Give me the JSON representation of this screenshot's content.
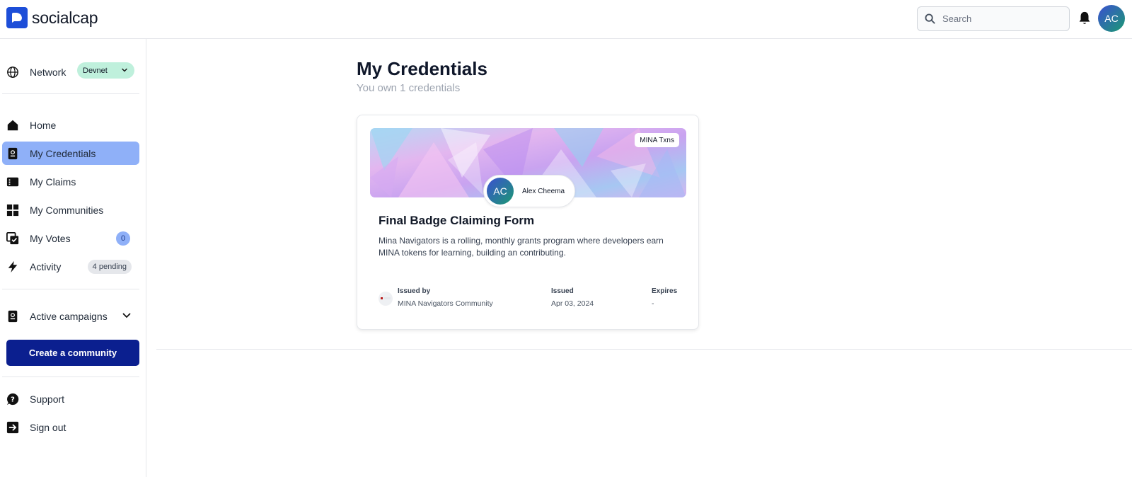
{
  "app": {
    "name": "socialcap"
  },
  "search": {
    "placeholder": "Search"
  },
  "user": {
    "initials": "AC"
  },
  "sidebar": {
    "network_label": "Network",
    "network_value": "Devnet",
    "items": [
      {
        "label": "Home",
        "icon": "home-icon"
      },
      {
        "label": "My Credentials",
        "icon": "credential-icon",
        "active": true
      },
      {
        "label": "My Claims",
        "icon": "claims-icon"
      },
      {
        "label": "My Communities",
        "icon": "grid-icon"
      },
      {
        "label": "My Votes",
        "icon": "votes-icon",
        "badge": "0"
      },
      {
        "label": "Activity",
        "icon": "bolt-icon",
        "badge": "4 pending"
      }
    ],
    "campaigns_label": "Active campaigns",
    "create_label": "Create a community",
    "support_label": "Support",
    "signout_label": "Sign out"
  },
  "main": {
    "title": "My Credentials",
    "subtitle": "You own 1 credentials"
  },
  "credential": {
    "tag": "MINA Txns",
    "owner_initials": "AC",
    "owner_name": "Alex Cheema",
    "title": "Final Badge Claiming Form",
    "description": "Mina Navigators is a rolling, monthly grants program where developers earn MINA tokens for learning, building an contributing.",
    "issued_by_label": "Issued by",
    "issued_by_value": "MINA Navigators Community",
    "issued_label": "Issued",
    "issued_value": "Apr 03, 2024",
    "expires_label": "Expires",
    "expires_value": "-"
  },
  "colors": {
    "brand": "#1d4ed8",
    "active_nav": "#8fb0f8",
    "create_button": "#0b1f8f",
    "network_pill": "#bff0dc"
  }
}
